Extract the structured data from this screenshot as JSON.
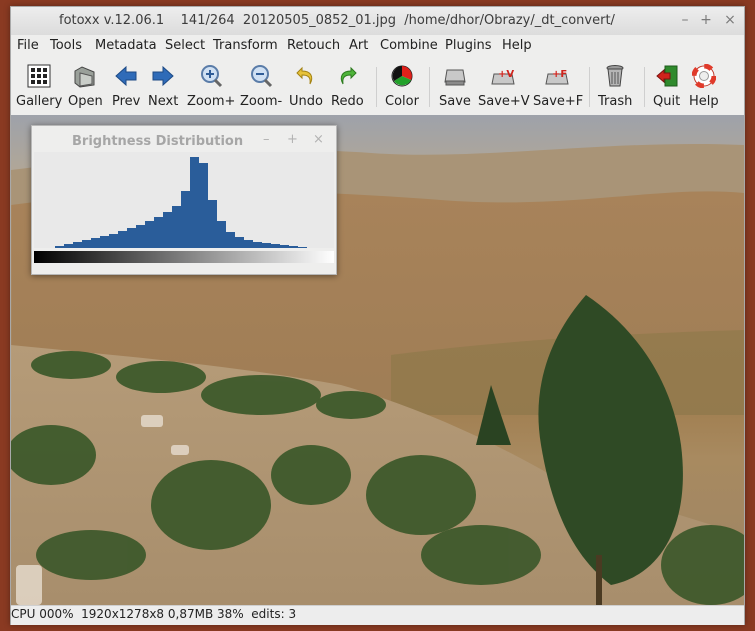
{
  "window": {
    "title": "fotoxx v.12.06.1    141/264  20120505_0852_01.jpg  /home/dhor/Obrazy/_dt_convert/"
  },
  "menu": [
    "File",
    "Tools",
    "Metadata",
    "Select",
    "Transform",
    "Retouch",
    "Art",
    "Combine",
    "Plugins",
    "Help"
  ],
  "toolbar": [
    {
      "label": "Gallery",
      "icon": "gallery-icon"
    },
    {
      "label": "Open",
      "icon": "open-icon"
    },
    {
      "label": "Prev",
      "icon": "prev-arrow-icon"
    },
    {
      "label": "Next",
      "icon": "next-arrow-icon"
    },
    {
      "label": "Zoom+",
      "icon": "zoom-in-icon"
    },
    {
      "label": "Zoom-",
      "icon": "zoom-out-icon"
    },
    {
      "label": "Undo",
      "icon": "undo-icon"
    },
    {
      "label": "Redo",
      "icon": "redo-icon"
    },
    {
      "label": "Color",
      "icon": "color-wheel-icon"
    },
    {
      "label": "Save",
      "icon": "save-icon"
    },
    {
      "label": "Save+V",
      "icon": "save-version-icon"
    },
    {
      "label": "Save+F",
      "icon": "save-file-icon"
    },
    {
      "label": "Trash",
      "icon": "trash-icon"
    },
    {
      "label": "Quit",
      "icon": "quit-icon"
    },
    {
      "label": "Help",
      "icon": "help-lifebuoy-icon"
    }
  ],
  "histogram": {
    "title": "Brightness Distribution",
    "bar_color": "#2a5d9a"
  },
  "status": {
    "text": "CPU 000%  1920x1278x8 0,87MB 38%  edits: 3"
  }
}
